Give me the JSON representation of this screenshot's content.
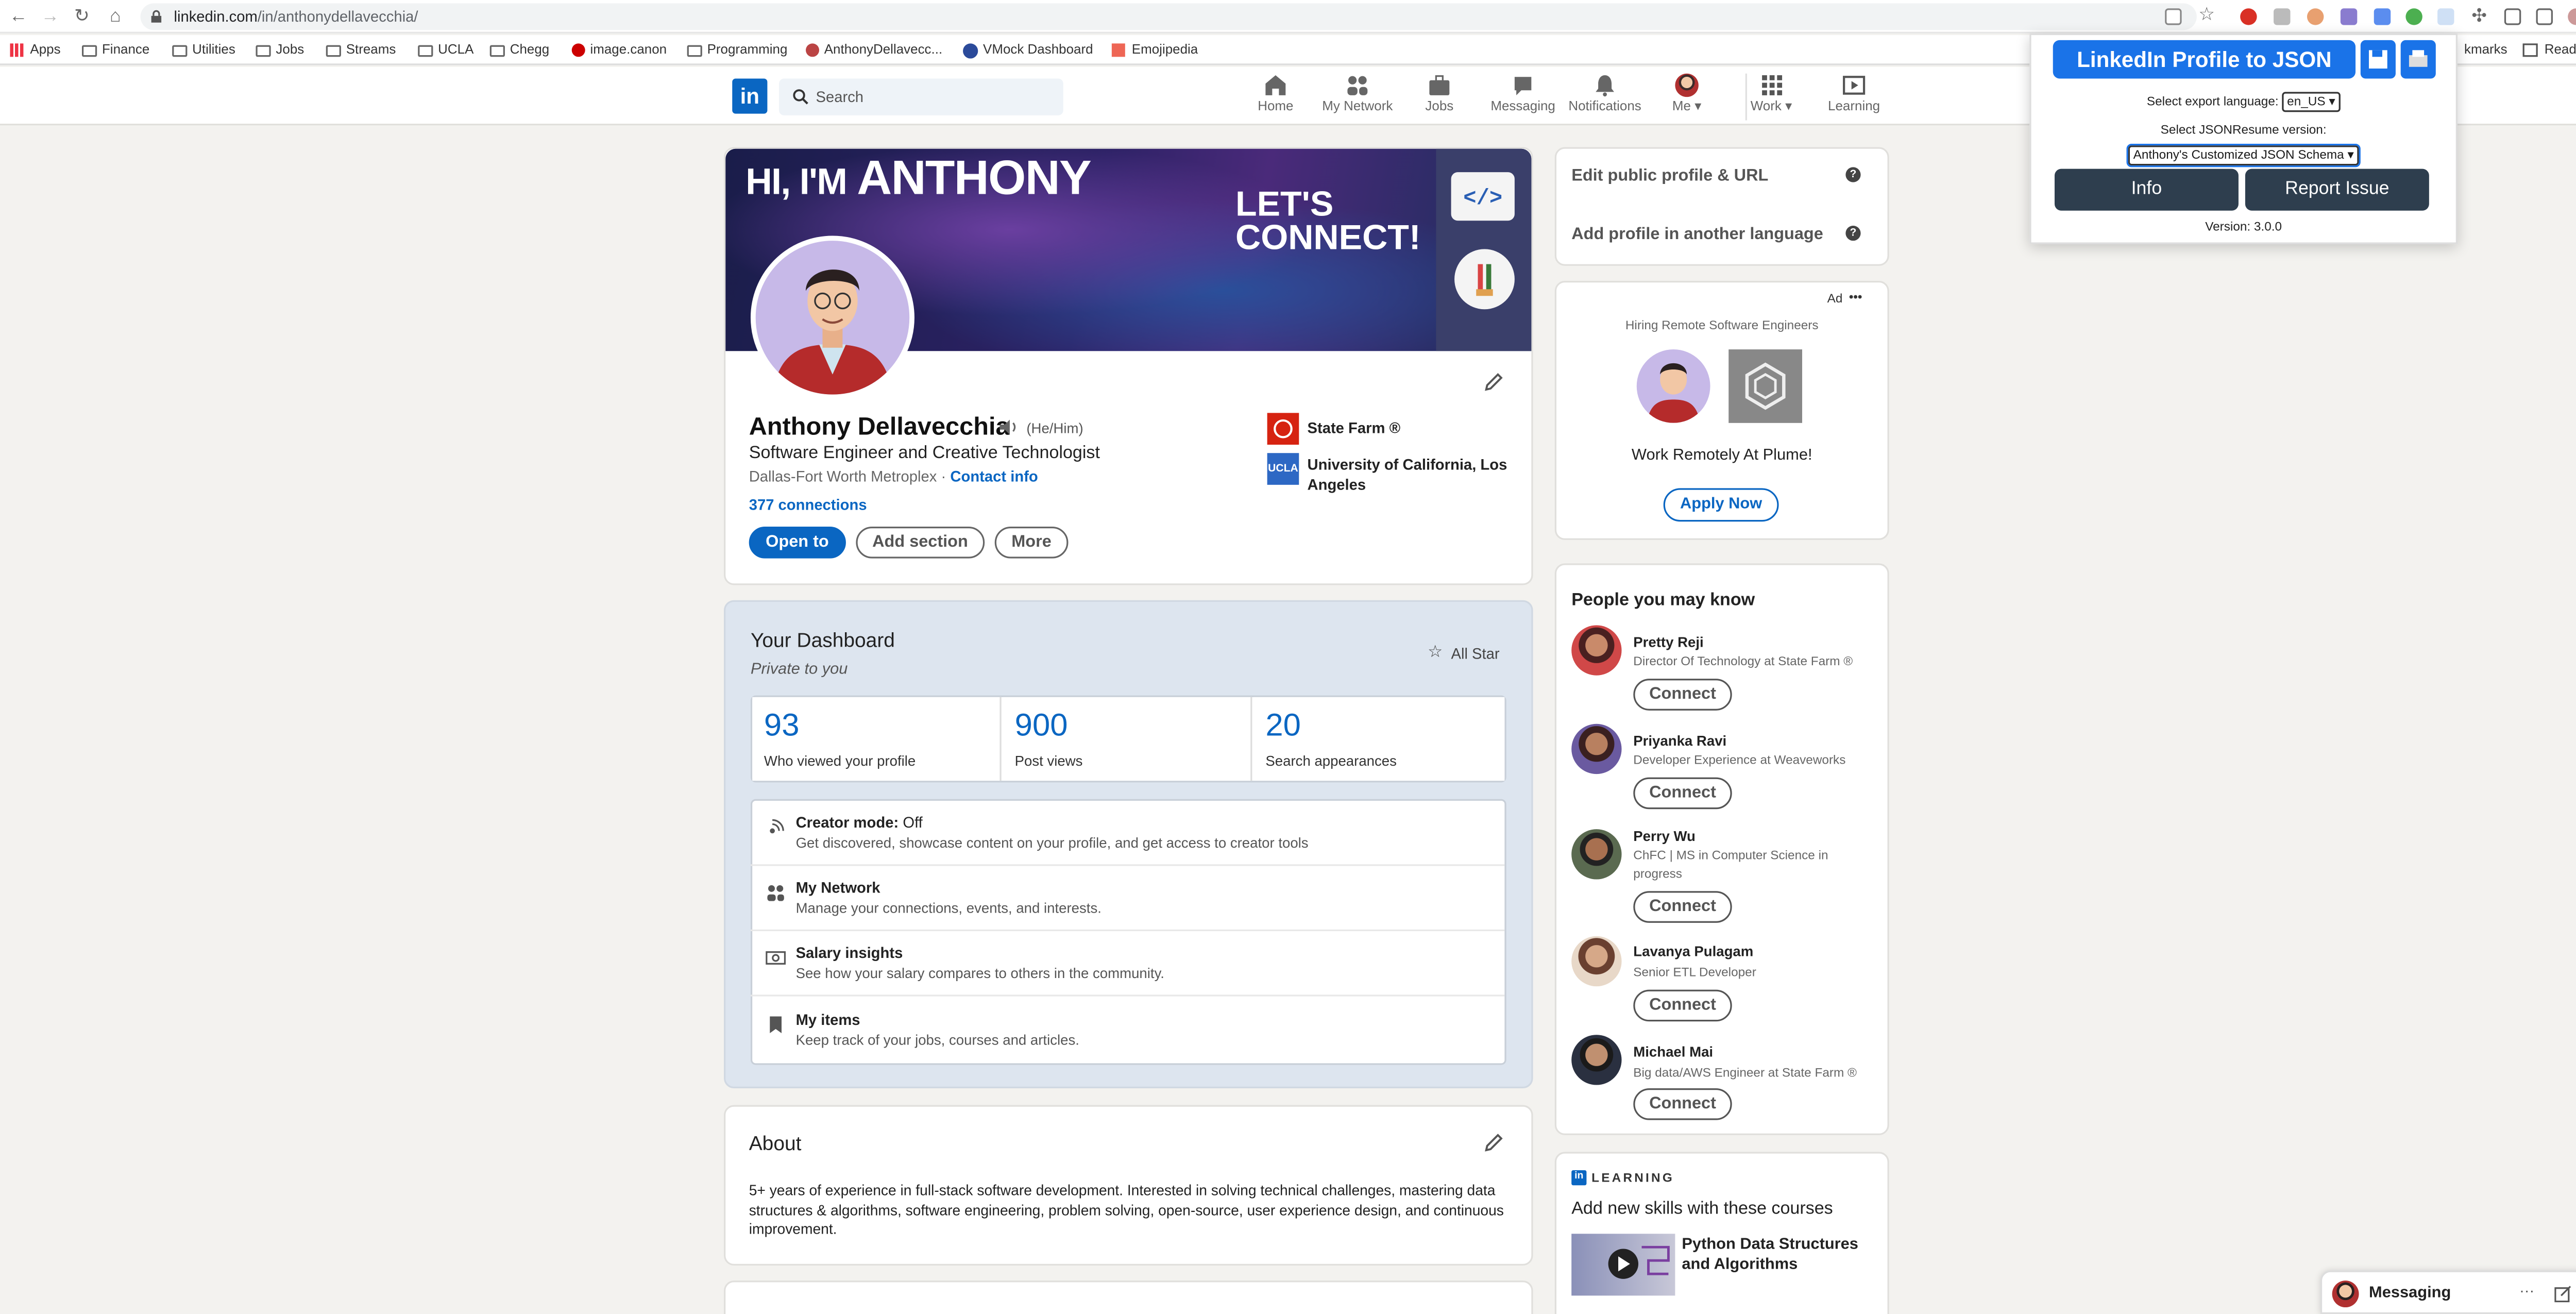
{
  "browser": {
    "url_domain": "linkedin.com",
    "url_path": "/in/anthonydellavecchia/",
    "bookmarks": [
      "Apps",
      "Finance",
      "Utilities",
      "Jobs",
      "Streams",
      "UCLA",
      "Chegg",
      "image.canon",
      "Programming",
      "AnthonyDellavecc...",
      "VMock Dashboard",
      "Emojipedia"
    ],
    "bookmarks_tail": "kmarks",
    "reading_list": "Reading List"
  },
  "nav": {
    "search_placeholder": "Search",
    "items": [
      "Home",
      "My Network",
      "Jobs",
      "Messaging",
      "Notifications",
      "Me",
      "Work",
      "Learning"
    ]
  },
  "profile": {
    "banner_hi": "HI, I'M",
    "banner_name": "ANTHONY",
    "banner_connect": "LET'S CONNECT!",
    "name": "Anthony Dellavecchia",
    "pronouns": "(He/Him)",
    "headline": "Software Engineer and Creative Technologist",
    "location": "Dallas-Fort Worth Metroplex",
    "separator": "·",
    "contact": "Contact info",
    "connections": "377 connections",
    "buttons": {
      "open_to": "Open to",
      "add_section": "Add section",
      "more": "More"
    },
    "company": "State Farm ®",
    "school": "University of California, Los Angeles",
    "school_logo": "UCLA"
  },
  "dashboard": {
    "title": "Your Dashboard",
    "subtitle": "Private to you",
    "badge": "All Star",
    "stats": [
      {
        "n": "93",
        "l": "Who viewed your profile"
      },
      {
        "n": "900",
        "l": "Post views"
      },
      {
        "n": "20",
        "l": "Search appearances"
      }
    ],
    "rows": [
      {
        "t": "Creator mode:",
        "t2": "Off",
        "s": "Get discovered, showcase content on your profile, and get access to creator tools"
      },
      {
        "t": "My Network",
        "s": "Manage your connections, events, and interests."
      },
      {
        "t": "Salary insights",
        "s": "See how your salary compares to others in the community."
      },
      {
        "t": "My items",
        "s": "Keep track of your jobs, courses and articles."
      }
    ]
  },
  "about": {
    "title": "About",
    "text": "5+ years of experience in full-stack software development. Interested in solving technical challenges, mastering data structures & algorithms, software engineering, problem solving, open-source, user experience design, and continuous improvement."
  },
  "right": {
    "edit_profile": "Edit public profile & URL",
    "add_language": "Add profile in another language",
    "ad_label": "Ad",
    "ad_menu": "•••",
    "ad_headline": "Hiring Remote Software Engineers",
    "ad_text": "Work Remotely At Plume!",
    "ad_button": "Apply Now",
    "pymk_title": "People you may know",
    "connect_label": "Connect",
    "people": [
      {
        "name": "Pretty Reji",
        "sub": "Director Of Technology at State Farm ®"
      },
      {
        "name": "Priyanka Ravi",
        "sub": "Developer Experience at Weaveworks"
      },
      {
        "name": "Perry Wu",
        "sub": "ChFC | MS in Computer Science in progress"
      },
      {
        "name": "Lavanya Pulagam",
        "sub": "Senior ETL Developer"
      },
      {
        "name": "Michael Mai",
        "sub": "Big data/AWS Engineer at State Farm ®"
      }
    ],
    "learning_label": "LEARNING",
    "learning_title": "Add new skills with these courses",
    "course": "Python Data Structures and Algorithms"
  },
  "messaging": {
    "label": "Messaging"
  },
  "extension": {
    "title": "LinkedIn Profile to JSON",
    "lang_label": "Select export language:",
    "lang_value": "en_US",
    "version_label": "Select JSONResume version:",
    "version_value": "Anthony's Customized JSON Schema",
    "info": "Info",
    "report": "Report Issue",
    "version": "Version: 3.0.0"
  }
}
